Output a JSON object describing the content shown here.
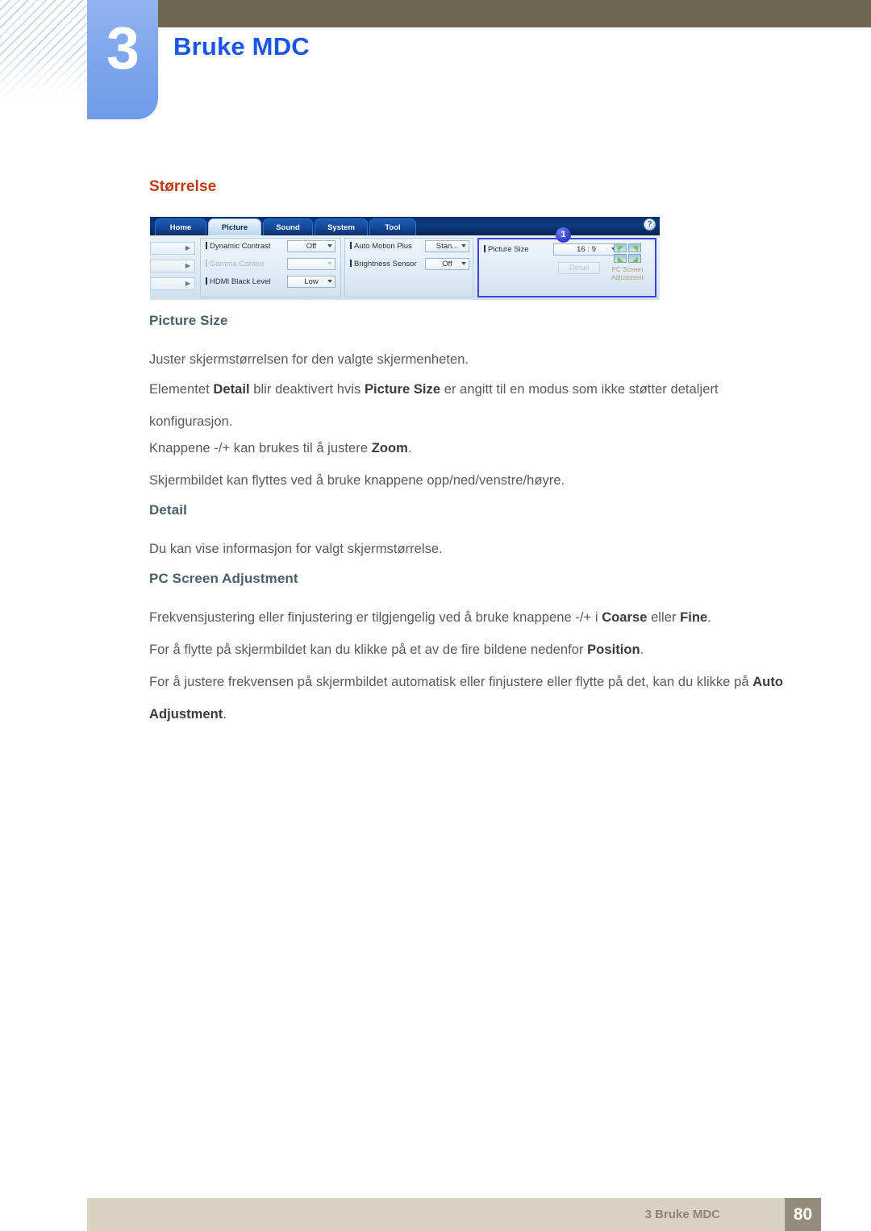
{
  "header": {
    "chapter_number": "3",
    "chapter_title": "Bruke MDC"
  },
  "section": {
    "heading": "Størrelse"
  },
  "mdc_screenshot": {
    "tabs": [
      {
        "label": "Home",
        "active": false
      },
      {
        "label": "Picture",
        "active": true
      },
      {
        "label": "Sound",
        "active": false
      },
      {
        "label": "System",
        "active": false
      },
      {
        "label": "Tool",
        "active": false
      }
    ],
    "help_icon": "?",
    "left_column": [
      {
        "label": "Dynamic Contrast",
        "value": "Off",
        "disabled": false
      },
      {
        "label": "Gamma Control",
        "value": "",
        "disabled": true
      },
      {
        "label": "HDMI Black Level",
        "value": "Low",
        "disabled": false
      }
    ],
    "middle_column": [
      {
        "label": "Auto Motion Plus",
        "value": "Stan...",
        "disabled": false
      },
      {
        "label": "Brightness Sensor",
        "value": "Off",
        "disabled": false
      }
    ],
    "right_panel": {
      "callout_badge": "1",
      "picture_size_label": "Picture Size",
      "picture_size_value": "16 : 9",
      "detail_button": "Detail",
      "pc_screen_adjustment_caption": "PC Screen Adjustment"
    }
  },
  "body": {
    "sub_picture_size": "Picture Size",
    "p1": "Juster skjermstørrelsen for den valgte skjermenheten.",
    "p2_a": "Elementet ",
    "p2_b1": "Detail",
    "p2_c": " blir deaktivert hvis ",
    "p2_b2": "Picture Size",
    "p2_d": " er angitt til en modus som ikke støtter detaljert konfigurasjon.",
    "p3_a": "Knappene -/+ kan brukes til å justere ",
    "p3_b": "Zoom",
    "p3_c": ".",
    "p4": "Skjermbildet kan flyttes ved å bruke knappene opp/ned/venstre/høyre.",
    "sub_detail": "Detail",
    "p5": "Du kan vise informasjon for valgt skjermstørrelse.",
    "sub_pc_screen_adjustment": "PC Screen Adjustment",
    "p6_a": "Frekvensjustering eller finjustering er tilgjengelig ved å bruke knappene -/+ i ",
    "p6_b1": "Coarse",
    "p6_c": " eller ",
    "p6_b2": "Fine",
    "p6_d": ".",
    "p7_a": "For å flytte på skjermbildet kan du klikke på et av de fire bildene nedenfor ",
    "p7_b": "Position",
    "p7_c": ".",
    "p8_a": "For å justere frekvensen på skjermbildet automatisk eller finjustere eller flytte på det, kan du klikke på ",
    "p8_b": "Auto Adjustment",
    "p8_c": "."
  },
  "footer": {
    "label": "3 Bruke MDC",
    "page_number": "80"
  },
  "colors": {
    "chapter_accent": "#1a54ef",
    "section_heading": "#c0380f",
    "sub_heading": "#49606b",
    "body_text": "#58595b",
    "header_band": "#6b6751",
    "footer_band": "#d9d4c1",
    "footer_page_box": "#968c7e"
  }
}
